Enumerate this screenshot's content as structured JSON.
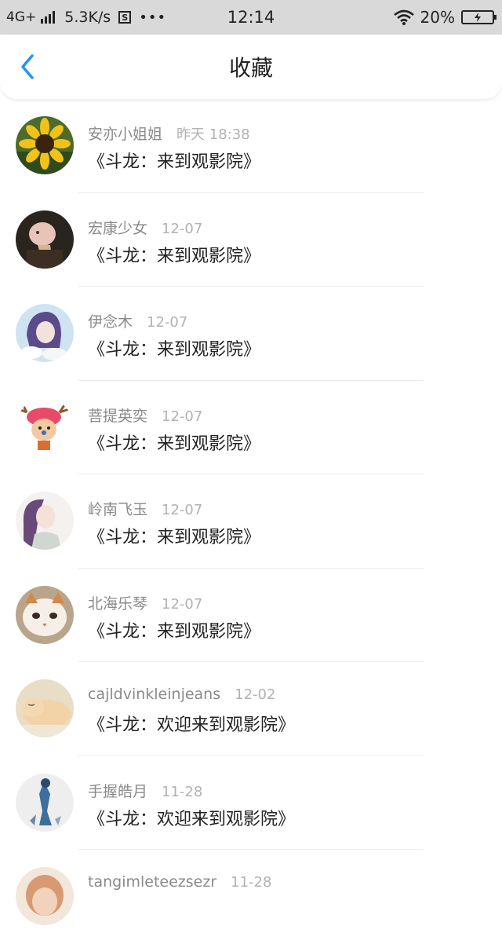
{
  "status_bar": {
    "network": "4G+",
    "speed": "5.3K/s",
    "s_badge": "S",
    "more": "•••",
    "time": "12:14",
    "battery_percent": "20%"
  },
  "nav": {
    "back_icon": "chevron-left-icon",
    "title": "收藏"
  },
  "colors": {
    "accent": "#2196f3",
    "status_bar_bg": "#d9d9d9"
  },
  "items": [
    {
      "name": "安亦小姐姐",
      "date": "昨天 18:38",
      "message": "《斗龙：来到观影院》"
    },
    {
      "name": "宏康少女",
      "date": "12-07",
      "message": "《斗龙：来到观影院》"
    },
    {
      "name": "伊念木",
      "date": "12-07",
      "message": "《斗龙：来到观影院》"
    },
    {
      "name": "菩提英奕",
      "date": "12-07",
      "message": "《斗龙：来到观影院》"
    },
    {
      "name": "岭南飞玉",
      "date": "12-07",
      "message": "《斗龙：来到观影院》"
    },
    {
      "name": "北海乐琴",
      "date": "12-07",
      "message": "《斗龙：来到观影院》"
    },
    {
      "name": "cajldvinkleinjeans",
      "date": "12-02",
      "message": "《斗龙：欢迎来到观影院》"
    },
    {
      "name": "手握皓月",
      "date": "11-28",
      "message": "《斗龙：欢迎来到观影院》"
    },
    {
      "name": "tangimleteezsezr",
      "date": "11-28",
      "message": ""
    }
  ]
}
